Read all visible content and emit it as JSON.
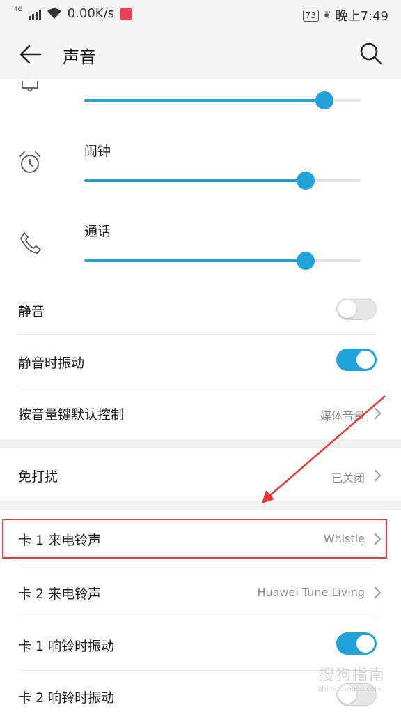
{
  "status_bar": {
    "network": "4G",
    "speed": "0.00K/s",
    "battery": "73",
    "time": "晚上7:49"
  },
  "header": {
    "title": "声音"
  },
  "volume": {
    "ringtone": {
      "level": 0.87
    },
    "alarm": {
      "label": "闹钟",
      "level": 0.8
    },
    "call": {
      "label": "通话",
      "level": 0.8
    }
  },
  "settings": {
    "mute": {
      "label": "静音",
      "state": "off"
    },
    "vibrate_on_mute": {
      "label": "静音时振动",
      "state": "on"
    },
    "volume_key_control": {
      "label": "按音量键默认控制",
      "value": "媒体音量"
    },
    "do_not_disturb": {
      "label": "免打扰",
      "value": "已关闭"
    },
    "sim1_ringtone": {
      "label": "卡 1 来电铃声",
      "value": "Whistle"
    },
    "sim2_ringtone": {
      "label": "卡 2 来电铃声",
      "value": "Huawei Tune Living"
    },
    "sim1_vibrate": {
      "label": "卡 1 响铃时振动",
      "state": "on"
    },
    "sim2_vibrate": {
      "label": "卡 2 响铃时振动",
      "state": "off"
    }
  },
  "watermark": {
    "text": "搜狗指南",
    "sub": "zhinan.sogou.com"
  },
  "colors": {
    "accent": "#1fa3d8",
    "annotation": "#e53935"
  }
}
